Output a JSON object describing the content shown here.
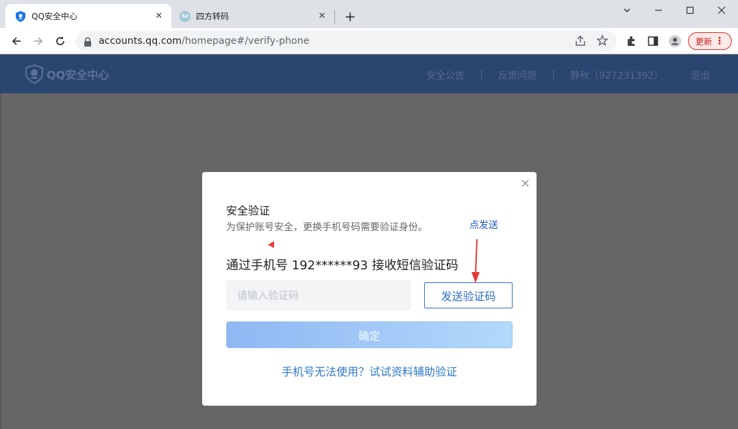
{
  "browser": {
    "tabs": [
      {
        "title": "QQ安全中心",
        "icon": "shield-icon"
      },
      {
        "title": "四方转码",
        "icon": "sz-icon",
        "icon_text": "Sz"
      }
    ],
    "new_tab": "+",
    "window_controls": {
      "minimize": "—",
      "maximize": "□",
      "close": "✕"
    },
    "url_host": "accounts.qq.com",
    "url_path": "/homepage#/verify-phone",
    "update_label": "更新",
    "update_menu": "⋮"
  },
  "header": {
    "brand": "QQ安全中心",
    "nav": [
      "安全公告",
      "反馈问题",
      "静秋（927231392）",
      "退出"
    ]
  },
  "dialog": {
    "close": "×",
    "title": "安全验证",
    "description": "为保护账号安全，更换手机号码需要验证身份。",
    "annotation": "点发送",
    "phone_prompt": "通过手机号 192******93 接收短信验证码",
    "code_placeholder": "请输入验证码",
    "send_code_label": "发送验证码",
    "confirm_label": "确定",
    "alt_link": "手机号无法使用？试试资料辅助验证"
  },
  "colors": {
    "header_bg": "#2a4570",
    "link_blue": "#2f78c8",
    "annotation_red": "#e53935",
    "update_red": "#d93025"
  }
}
